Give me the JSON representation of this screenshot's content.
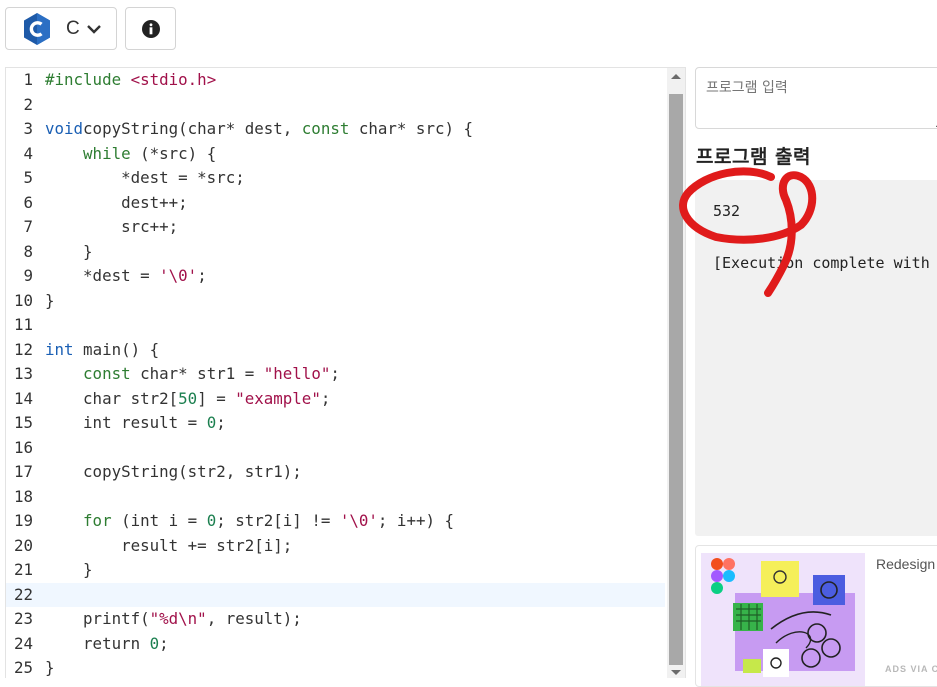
{
  "toolbar": {
    "language_label": "C",
    "language_icon": "c-language-logo-icon",
    "dropdown_icon": "chevron-down-icon",
    "info_icon": "info-icon"
  },
  "editor": {
    "active_line": 22,
    "lines": [
      {
        "n": "1",
        "segs": [
          [
            "inc",
            "#include "
          ],
          [
            "hdr",
            "<stdio.h>"
          ]
        ]
      },
      {
        "n": "2",
        "segs": []
      },
      {
        "n": "3",
        "segs": [
          [
            "kw",
            "void"
          ],
          [
            "",
            "copyString(char* dest, "
          ],
          [
            "kw2",
            "const"
          ],
          [
            "",
            " char* src) {"
          ]
        ]
      },
      {
        "n": "4",
        "segs": [
          [
            "",
            "    "
          ],
          [
            "kw2",
            "while"
          ],
          [
            "",
            " (*src) {"
          ]
        ]
      },
      {
        "n": "5",
        "segs": [
          [
            "",
            "        *dest = *src;"
          ]
        ]
      },
      {
        "n": "6",
        "segs": [
          [
            "",
            "        dest++;"
          ]
        ]
      },
      {
        "n": "7",
        "segs": [
          [
            "",
            "        src++;"
          ]
        ]
      },
      {
        "n": "8",
        "segs": [
          [
            "",
            "    }"
          ]
        ]
      },
      {
        "n": "9",
        "segs": [
          [
            "",
            "    *dest = "
          ],
          [
            "str",
            "'\\0'"
          ],
          [
            "",
            ";"
          ]
        ]
      },
      {
        "n": "10",
        "segs": [
          [
            "",
            "}"
          ]
        ]
      },
      {
        "n": "11",
        "segs": []
      },
      {
        "n": "12",
        "segs": [
          [
            "kw",
            "int"
          ],
          [
            "",
            " main() {"
          ]
        ]
      },
      {
        "n": "13",
        "segs": [
          [
            "",
            "    "
          ],
          [
            "kw2",
            "const"
          ],
          [
            "",
            " char* str1 = "
          ],
          [
            "str",
            "\"hello\""
          ],
          [
            "",
            ";"
          ]
        ]
      },
      {
        "n": "14",
        "segs": [
          [
            "",
            "    char str2["
          ],
          [
            "num",
            "50"
          ],
          [
            "",
            "] = "
          ],
          [
            "str",
            "\"example\""
          ],
          [
            "",
            ";"
          ]
        ]
      },
      {
        "n": "15",
        "segs": [
          [
            "",
            "    int result = "
          ],
          [
            "num",
            "0"
          ],
          [
            "",
            ";"
          ]
        ]
      },
      {
        "n": "16",
        "segs": []
      },
      {
        "n": "17",
        "segs": [
          [
            "",
            "    copyString(str2, str1);"
          ]
        ]
      },
      {
        "n": "18",
        "segs": []
      },
      {
        "n": "19",
        "segs": [
          [
            "",
            "    "
          ],
          [
            "kw2",
            "for"
          ],
          [
            "",
            " (int i = "
          ],
          [
            "num",
            "0"
          ],
          [
            "",
            "; str2[i] != "
          ],
          [
            "str",
            "'\\0'"
          ],
          [
            "",
            "; i++) {"
          ]
        ]
      },
      {
        "n": "20",
        "segs": [
          [
            "",
            "        result += str2[i];"
          ]
        ]
      },
      {
        "n": "21",
        "segs": [
          [
            "",
            "    }"
          ]
        ]
      },
      {
        "n": "22",
        "segs": []
      },
      {
        "n": "23",
        "segs": [
          [
            "",
            "    printf("
          ],
          [
            "str",
            "\"%d\\n\""
          ],
          [
            "",
            ", result);"
          ]
        ]
      },
      {
        "n": "24",
        "segs": [
          [
            "",
            "    return "
          ],
          [
            "num",
            "0"
          ],
          [
            "",
            ";"
          ]
        ]
      },
      {
        "n": "25",
        "segs": [
          [
            "",
            "}"
          ]
        ]
      }
    ]
  },
  "program_input": {
    "placeholder": "프로그램 입력"
  },
  "program_output": {
    "heading": "프로그램 출력",
    "lines": [
      "532",
      "",
      "[Execution complete with"
    ]
  },
  "ad": {
    "title": "Redesign",
    "via_label": "ADS VIA C",
    "image_icon": "figma-illustration-icon"
  },
  "annotation": {
    "color": "#e01b1b"
  },
  "colors": {
    "keyword": "#1a5fb4",
    "keyword_control": "#2e7d32",
    "string": "#a1114a",
    "number": "#1b7f4f",
    "active_line_bg": "#f0f7ff",
    "output_bg": "#f1f1f1"
  }
}
